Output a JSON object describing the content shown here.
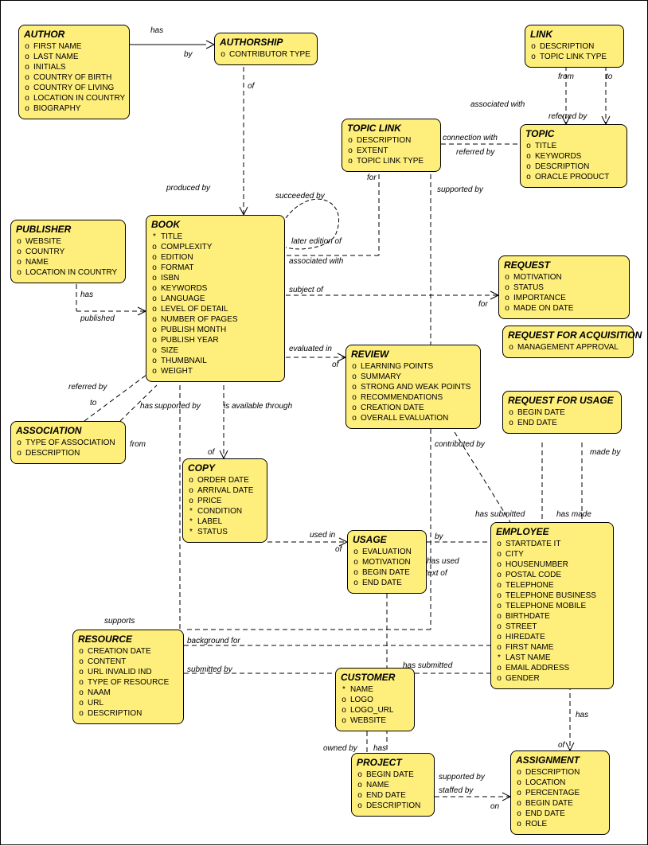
{
  "entities": {
    "author": {
      "title": "AUTHOR",
      "attrs": [
        [
          "o",
          "FIRST NAME"
        ],
        [
          "o",
          "LAST NAME"
        ],
        [
          "o",
          "INITIALS"
        ],
        [
          "o",
          "COUNTRY OF BIRTH"
        ],
        [
          "o",
          "COUNTRY OF LIVING"
        ],
        [
          "o",
          "LOCATION IN COUNTRY"
        ],
        [
          "o",
          "BIOGRAPHY"
        ]
      ]
    },
    "authorship": {
      "title": "AUTHORSHIP",
      "attrs": [
        [
          "o",
          "CONTRIBUTOR TYPE"
        ]
      ]
    },
    "link": {
      "title": "LINK",
      "attrs": [
        [
          "o",
          "DESCRIPTION"
        ],
        [
          "o",
          "TOPIC LINK TYPE"
        ]
      ]
    },
    "topiclink": {
      "title": "TOPIC LINK",
      "attrs": [
        [
          "o",
          "DESCRIPTION"
        ],
        [
          "o",
          "EXTENT"
        ],
        [
          "o",
          "TOPIC LINK TYPE"
        ]
      ]
    },
    "topic": {
      "title": "TOPIC",
      "attrs": [
        [
          "o",
          "TITLE"
        ],
        [
          "o",
          "KEYWORDS"
        ],
        [
          "o",
          "DESCRIPTION"
        ],
        [
          "o",
          "ORACLE PRODUCT"
        ]
      ]
    },
    "publisher": {
      "title": "PUBLISHER",
      "attrs": [
        [
          "o",
          "WEBSITE"
        ],
        [
          "o",
          "COUNTRY"
        ],
        [
          "o",
          "NAME"
        ],
        [
          "o",
          "LOCATION IN COUNTRY"
        ]
      ]
    },
    "book": {
      "title": "BOOK",
      "attrs": [
        [
          "*",
          "TITLE"
        ],
        [
          "o",
          "COMPLEXITY"
        ],
        [
          "o",
          "EDITION"
        ],
        [
          "o",
          "FORMAT"
        ],
        [
          "o",
          "ISBN"
        ],
        [
          "o",
          "KEYWORDS"
        ],
        [
          "o",
          "LANGUAGE"
        ],
        [
          "o",
          "LEVEL OF DETAIL"
        ],
        [
          "o",
          "NUMBER OF PAGES"
        ],
        [
          "o",
          "PUBLISH MONTH"
        ],
        [
          "o",
          "PUBLISH YEAR"
        ],
        [
          "o",
          "SIZE"
        ],
        [
          "o",
          "THUMBNAIL"
        ],
        [
          "o",
          "WEIGHT"
        ]
      ]
    },
    "request": {
      "title": "REQUEST",
      "attrs": [
        [
          "o",
          "MOTIVATION"
        ],
        [
          "o",
          "STATUS"
        ],
        [
          "o",
          "IMPORTANCE"
        ],
        [
          "o",
          "MADE ON DATE"
        ]
      ]
    },
    "reqacq": {
      "title": "REQUEST FOR ACQUISITION",
      "attrs": [
        [
          "o",
          "MANAGEMENT APPROVAL"
        ]
      ]
    },
    "requsage": {
      "title": "REQUEST FOR USAGE",
      "attrs": [
        [
          "o",
          "BEGIN DATE"
        ],
        [
          "o",
          "END DATE"
        ]
      ]
    },
    "association": {
      "title": "ASSOCIATION",
      "attrs": [
        [
          "o",
          "TYPE OF ASSOCIATION"
        ],
        [
          "o",
          "DESCRIPTION"
        ]
      ]
    },
    "review": {
      "title": "REVIEW",
      "attrs": [
        [
          "o",
          "LEARNING POINTS"
        ],
        [
          "o",
          "SUMMARY"
        ],
        [
          "o",
          "STRONG AND WEAK POINTS"
        ],
        [
          "o",
          "RECOMMENDATIONS"
        ],
        [
          "o",
          "CREATION DATE"
        ],
        [
          "o",
          "OVERALL EVALUATION"
        ]
      ]
    },
    "copy": {
      "title": "COPY",
      "attrs": [
        [
          "o",
          "ORDER DATE"
        ],
        [
          "o",
          "ARRIVAL DATE"
        ],
        [
          "o",
          "PRICE"
        ],
        [
          "*",
          "CONDITION"
        ],
        [
          "*",
          "LABEL"
        ],
        [
          "*",
          "STATUS"
        ]
      ]
    },
    "usage": {
      "title": "USAGE",
      "attrs": [
        [
          "o",
          "EVALUATION"
        ],
        [
          "o",
          "MOTIVATION"
        ],
        [
          "o",
          "BEGIN DATE"
        ],
        [
          "o",
          "END DATE"
        ]
      ]
    },
    "employee": {
      "title": "EMPLOYEE",
      "attrs": [
        [
          "o",
          "STARTDATE IT"
        ],
        [
          "o",
          "CITY"
        ],
        [
          "o",
          "HOUSENUMBER"
        ],
        [
          "o",
          "POSTAL CODE"
        ],
        [
          "o",
          "TELEPHONE"
        ],
        [
          "o",
          "TELEPHONE BUSINESS"
        ],
        [
          "o",
          "TELEPHONE MOBILE"
        ],
        [
          "o",
          "BIRTHDATE"
        ],
        [
          "o",
          "STREET"
        ],
        [
          "o",
          "HIREDATE"
        ],
        [
          "o",
          "FIRST NAME"
        ],
        [
          "*",
          "LAST NAME"
        ],
        [
          "o",
          "EMAIL ADDRESS"
        ],
        [
          "o",
          "GENDER"
        ]
      ]
    },
    "resource": {
      "title": "RESOURCE",
      "attrs": [
        [
          "o",
          "CREATION DATE"
        ],
        [
          "o",
          "CONTENT"
        ],
        [
          "o",
          "URL INVALID IND"
        ],
        [
          "o",
          "TYPE OF RESOURCE"
        ],
        [
          "o",
          "NAAM"
        ],
        [
          "o",
          "URL"
        ],
        [
          "o",
          "DESCRIPTION"
        ]
      ]
    },
    "customer": {
      "title": "CUSTOMER",
      "attrs": [
        [
          "*",
          "NAME"
        ],
        [
          "o",
          "LOGO"
        ],
        [
          "o",
          "LOGO_URL"
        ],
        [
          "o",
          "WEBSITE"
        ]
      ]
    },
    "project": {
      "title": "PROJECT",
      "attrs": [
        [
          "o",
          "BEGIN DATE"
        ],
        [
          "o",
          "NAME"
        ],
        [
          "o",
          "END DATE"
        ],
        [
          "o",
          "DESCRIPTION"
        ]
      ]
    },
    "assignment": {
      "title": "ASSIGNMENT",
      "attrs": [
        [
          "o",
          "DESCRIPTION"
        ],
        [
          "o",
          "LOCATION"
        ],
        [
          "o",
          "PERCENTAGE"
        ],
        [
          "o",
          "BEGIN DATE"
        ],
        [
          "o",
          "END DATE"
        ],
        [
          "o",
          "ROLE"
        ]
      ]
    }
  },
  "labels": {
    "has1": "has",
    "by": "by",
    "of1": "of",
    "producedby": "produced by",
    "succeededby": "succeeded by",
    "latereditionof": "later edition of",
    "associatedwith1": "associated with",
    "connectionwith": "connection with",
    "referredby1": "referred by",
    "for1": "for",
    "supportedby1": "supported by",
    "from1": "from",
    "to1": "to",
    "referredby2": "referred by",
    "associatedwith2": "associated with",
    "has2": "has",
    "published": "published",
    "subjectof": "subject of",
    "for2": "for",
    "evaluatedin": "evaluated in",
    "of2": "of",
    "referredby3": "referred by",
    "to2": "to",
    "from2": "from",
    "hassupportedby": "has",
    "supportedby": "supported by",
    "isavailable": "is available through",
    "of3": "of",
    "usedin": "used in",
    "of4": "of",
    "by2": "by",
    "hasused": "has used",
    "contextof": "in the context of",
    "hassubmitted1": "has submitted",
    "hasmade": "has made",
    "madeby": "made by",
    "contributedby": "contributed by",
    "supports": "supports",
    "backgroundfor": "background for",
    "submittedby": "submitted by",
    "hassubmitted2": "has submitted",
    "ownedby": "owned by",
    "has3": "has",
    "staffedby": "staffed by",
    "supportedby2": "supported by",
    "on": "on",
    "has4": "has",
    "of5": "of"
  }
}
